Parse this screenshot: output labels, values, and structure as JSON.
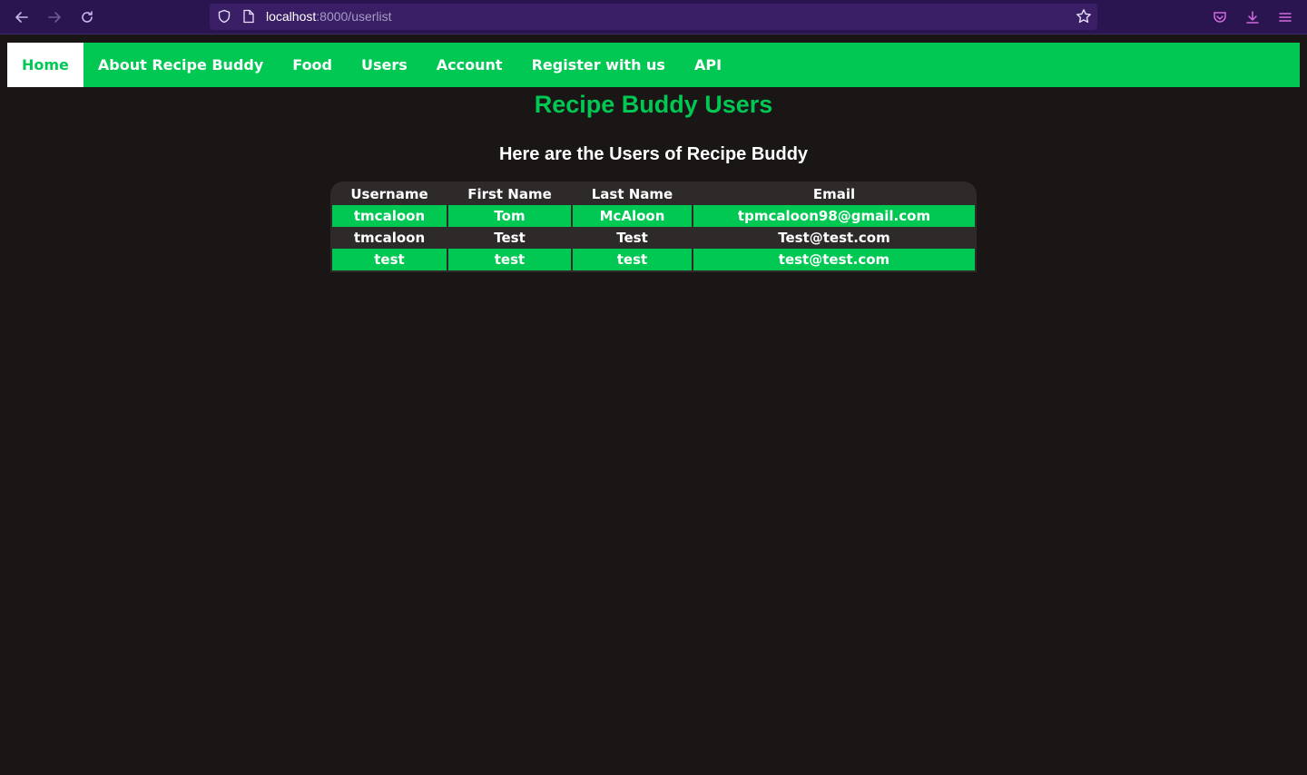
{
  "browser": {
    "url_host": "localhost",
    "url_path": ":8000/userlist"
  },
  "nav": {
    "items": [
      {
        "label": "Home",
        "active": true
      },
      {
        "label": "About Recipe Buddy"
      },
      {
        "label": "Food"
      },
      {
        "label": "Users"
      },
      {
        "label": "Account"
      },
      {
        "label": "Register with us"
      },
      {
        "label": "API"
      }
    ]
  },
  "page": {
    "title": "Recipe Buddy Users",
    "subtitle": "Here are the Users of Recipe Buddy"
  },
  "table": {
    "headers": [
      "Username",
      "First Name",
      "Last Name",
      "Email"
    ],
    "rows": [
      [
        "tmcaloon",
        "Tom",
        "McAloon",
        "tpmcaloon98@gmail.com"
      ],
      [
        "tmcaloon",
        "Test",
        "Test",
        "Test@test.com"
      ],
      [
        "test",
        "test",
        "test",
        "test@test.com"
      ]
    ]
  },
  "colors": {
    "accent": "#00c853",
    "background": "#1b1616",
    "chrome": "#2a1550"
  }
}
